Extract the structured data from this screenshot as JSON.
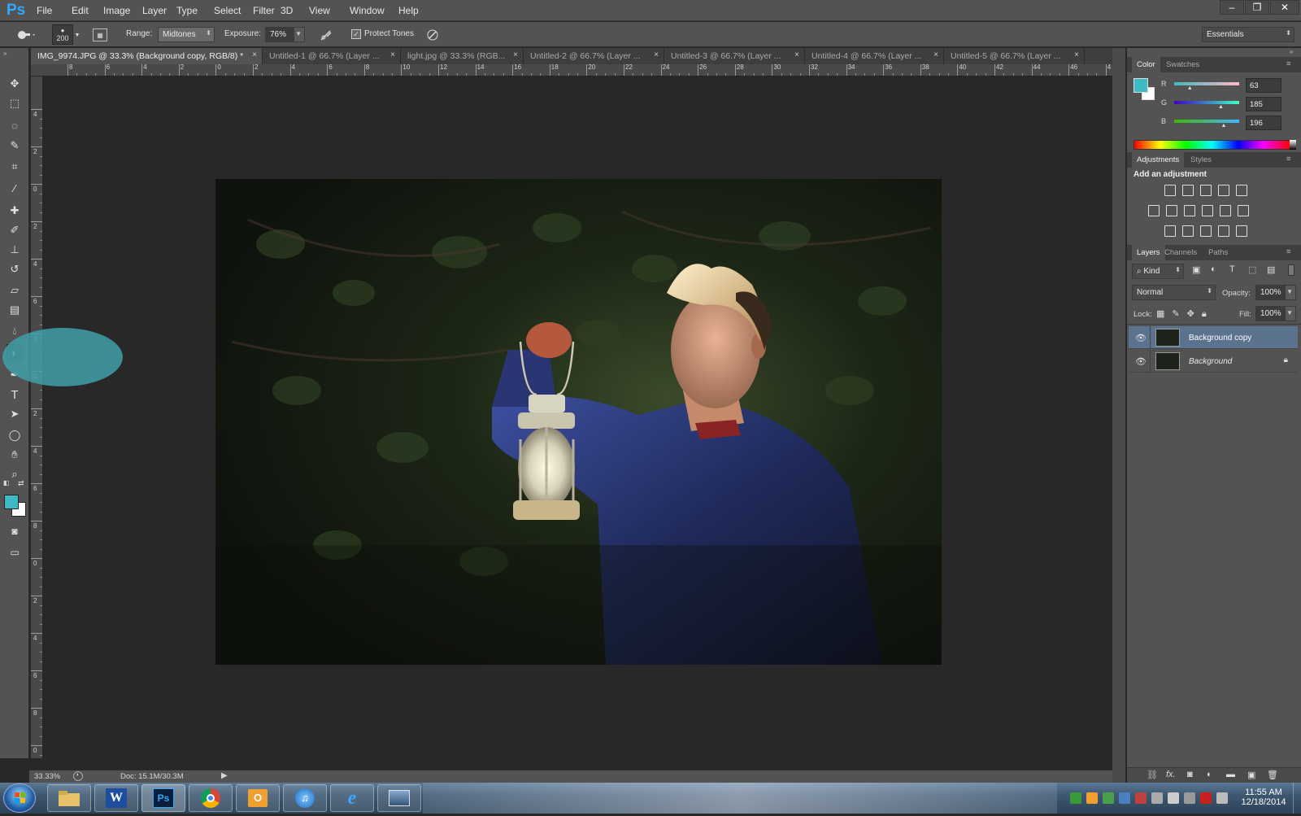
{
  "app": {
    "logo": "Ps"
  },
  "menu": [
    "File",
    "Edit",
    "Image",
    "Layer",
    "Type",
    "Select",
    "Filter",
    "3D",
    "View",
    "Window",
    "Help"
  ],
  "window_controls": {
    "minimize": "–",
    "restore": "❐",
    "close": "✕"
  },
  "options": {
    "brush_size": "200",
    "range_label": "Range:",
    "range_value": "Midtones",
    "exposure_label": "Exposure:",
    "exposure_value": "76%",
    "protect_tones_label": "Protect Tones",
    "protect_tones_checked": true,
    "workspace": "Essentials"
  },
  "tabs": [
    {
      "label": "IMG_9974.JPG @ 33.3% (Background copy, RGB/8) *",
      "active": true
    },
    {
      "label": "Untitled-1 @ 66.7% (Layer ...",
      "active": false
    },
    {
      "label": "light.jpg @ 33.3% (RGB...",
      "active": false
    },
    {
      "label": "Untitled-2 @ 66.7% (Layer ...",
      "active": false
    },
    {
      "label": "Untitled-3 @ 66.7% (Layer ...",
      "active": false
    },
    {
      "label": "Untitled-4 @ 66.7% (Layer ...",
      "active": false
    },
    {
      "label": "Untitled-5 @ 66.7% (Layer ...",
      "active": false
    }
  ],
  "tab_close": "×",
  "ruler_top": [
    "8",
    "6",
    "4",
    "2",
    "0",
    "2",
    "4",
    "6",
    "8",
    "10",
    "12",
    "14",
    "16",
    "18",
    "20",
    "22",
    "24",
    "26",
    "28",
    "30",
    "32",
    "34",
    "36",
    "38",
    "40",
    "42",
    "44",
    "46",
    "4"
  ],
  "ruler_left": [
    "4",
    "2",
    "0",
    "2",
    "4",
    "6",
    "8",
    "0",
    "2",
    "4",
    "6",
    "8",
    "0",
    "2",
    "4",
    "6",
    "8",
    "0"
  ],
  "tools": [
    "move-tool",
    "marquee-tool",
    "lasso-tool",
    "quick-select-tool",
    "crop-tool",
    "eyedropper-tool",
    "spot-healing-tool",
    "brush-tool",
    "clone-stamp-tool",
    "history-brush-tool",
    "eraser-tool",
    "gradient-tool",
    "blur-tool",
    "dodge-tool",
    "pen-tool",
    "type-tool",
    "path-selection-tool",
    "ellipse-tool",
    "hand-tool",
    "zoom-tool"
  ],
  "colors": {
    "foreground": "#3fb9c4",
    "background": "#ffffff",
    "highlight": "#3f9fa8",
    "selected_layer": "#5c7390"
  },
  "status": {
    "zoom": "33.33%",
    "doc": "Doc: 15.1M/30.3M"
  },
  "color_panel": {
    "tabs": [
      "Color",
      "Swatches"
    ],
    "channels": [
      {
        "label": "R",
        "value": "63"
      },
      {
        "label": "G",
        "value": "185"
      },
      {
        "label": "B",
        "value": "196"
      }
    ]
  },
  "adjustments_panel": {
    "tabs": [
      "Adjustments",
      "Styles"
    ],
    "heading": "Add an adjustment"
  },
  "layers_panel": {
    "tabs": [
      "Layers",
      "Channels",
      "Paths"
    ],
    "filter_kind": "Kind",
    "blend_mode": "Normal",
    "opacity_label": "Opacity:",
    "opacity_value": "100%",
    "lock_label": "Lock:",
    "fill_label": "Fill:",
    "fill_value": "100%",
    "layers": [
      {
        "name": "Background copy",
        "selected": true,
        "locked": false
      },
      {
        "name": "Background",
        "selected": false,
        "locked": true
      }
    ],
    "footer_fx": "fx."
  },
  "taskbar": {
    "apps": [
      "start-orb",
      "file-explorer",
      "word",
      "photoshop",
      "chrome",
      "outlook",
      "itunes",
      "internet-explorer",
      "windows-photo-viewer"
    ],
    "word_label": "W",
    "ps_label": "Ps",
    "time": "11:55 AM",
    "date": "12/18/2014"
  }
}
